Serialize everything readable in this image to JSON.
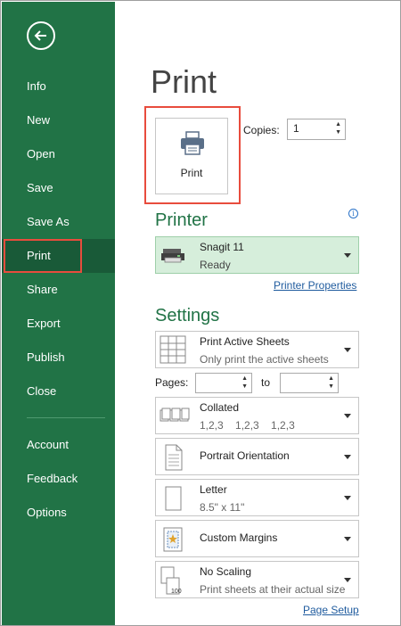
{
  "sidebar": {
    "items": [
      {
        "label": "Info"
      },
      {
        "label": "New"
      },
      {
        "label": "Open"
      },
      {
        "label": "Save"
      },
      {
        "label": "Save As"
      },
      {
        "label": "Print"
      },
      {
        "label": "Share"
      },
      {
        "label": "Export"
      },
      {
        "label": "Publish"
      },
      {
        "label": "Close"
      },
      {
        "label": "Account"
      },
      {
        "label": "Feedback"
      },
      {
        "label": "Options"
      }
    ],
    "active": "Print"
  },
  "main": {
    "title": "Print",
    "print_button_label": "Print",
    "copies_label": "Copies:",
    "copies_value": "1",
    "printer": {
      "header": "Printer",
      "name": "Snagit 11",
      "status": "Ready",
      "properties_link": "Printer Properties"
    },
    "settings": {
      "header": "Settings",
      "what": {
        "line1": "Print Active Sheets",
        "line2": "Only print the active sheets"
      },
      "pages_label": "Pages:",
      "to_label": "to",
      "collated": {
        "line1": "Collated",
        "line2": "1,2,3    1,2,3    1,2,3"
      },
      "orientation": {
        "line1": "Portrait Orientation"
      },
      "paper": {
        "line1": "Letter",
        "line2": "8.5\" x 11\""
      },
      "margins": {
        "line1": "Custom Margins"
      },
      "scaling": {
        "line1": "No Scaling",
        "line2": "Print sheets at their actual size"
      },
      "page_setup_link": "Page Setup"
    }
  },
  "colors": {
    "sidebar_bg": "#217346",
    "sidebar_active": "#195a38",
    "accent": "#217346",
    "highlight_box": "#e84c3d",
    "printer_selected_bg": "#d6eedb",
    "link": "#1f5b9e"
  }
}
